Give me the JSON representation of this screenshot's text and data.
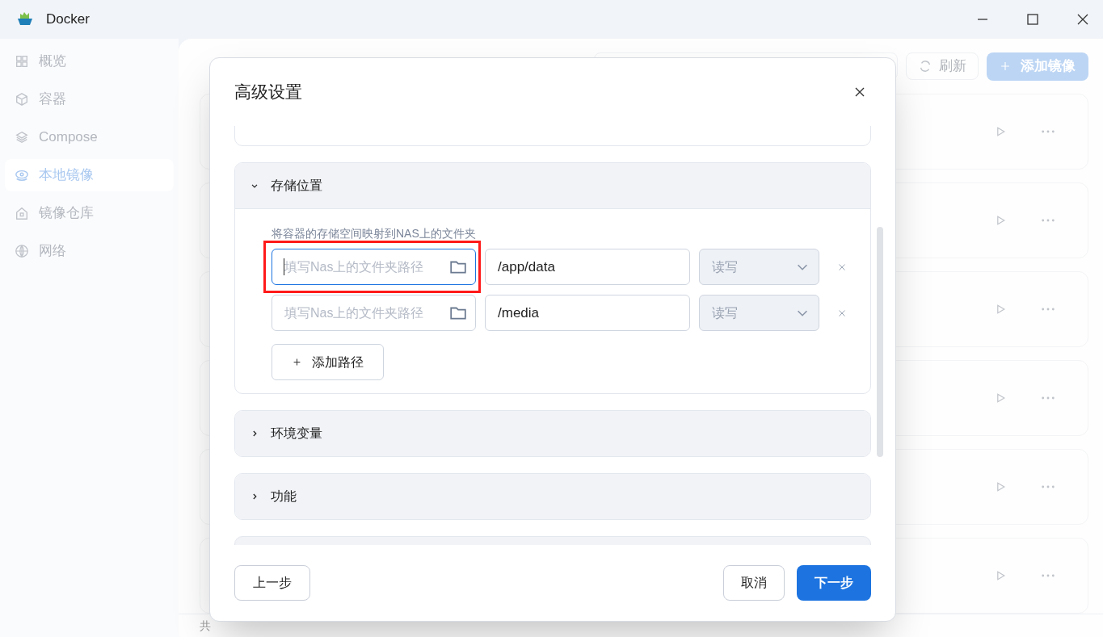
{
  "window": {
    "title": "Docker"
  },
  "sidebar": {
    "items": [
      {
        "label": "概览",
        "kind": "grid",
        "selected": false
      },
      {
        "label": "容器",
        "kind": "cube",
        "selected": false
      },
      {
        "label": "Compose",
        "kind": "layers",
        "selected": false
      },
      {
        "label": "本地镜像",
        "kind": "eye",
        "selected": true
      },
      {
        "label": "镜像仓库",
        "kind": "house",
        "selected": false
      },
      {
        "label": "网络",
        "kind": "globe",
        "selected": false
      }
    ]
  },
  "page": {
    "refresh_button": "刷新",
    "add_button": "添加镜像",
    "footer": "共"
  },
  "dialog": {
    "title": "高级设置",
    "sections": [
      {
        "title": "存储位置",
        "expanded": true,
        "description": "将容器的存储空间映射到NAS上的文件夹",
        "mounts": [
          {
            "host_placeholder": "填写Nas上的文件夹路径",
            "container_path": "/app/data",
            "mode": "读写",
            "focused": true,
            "highlighted": true
          },
          {
            "host_placeholder": "填写Nas上的文件夹路径",
            "container_path": "/media",
            "mode": "读写",
            "focused": false,
            "highlighted": false
          }
        ],
        "add_button": "添加路径"
      },
      {
        "title": "环境变量",
        "expanded": false
      },
      {
        "title": "功能",
        "expanded": false
      }
    ],
    "back_button": "上一步",
    "cancel_button": "取消",
    "next_button": "下一步"
  }
}
